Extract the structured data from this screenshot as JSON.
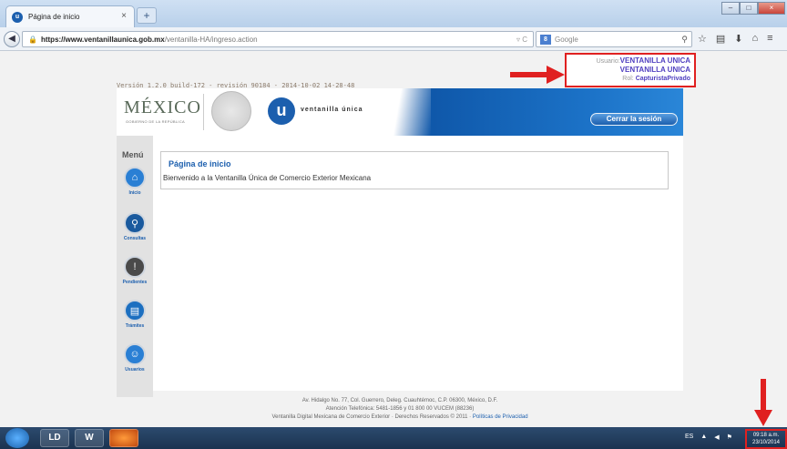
{
  "browser": {
    "tab_title": "Página de inicio",
    "tab_close": "×",
    "new_tab": "+",
    "url_host": "https://www.ventanillaunica.gob.mx",
    "url_path": "/ventanilla-HA/ingreso.action",
    "url_controls": "▿ C",
    "search_engine_letter": "8",
    "search_placeholder": "Google",
    "win_min": "–",
    "win_max": "□",
    "win_close": "×"
  },
  "page": {
    "version": "Versión 1.2.0 build-172 - revisión 90184 - 2014-10-02_14-28-48",
    "user_label": "Usuario:",
    "user_name_1": "VENTANILLA UNICA",
    "user_name_2": "VENTANILLA UNICA",
    "rol_label": "Rol:",
    "rol_value": "CapturistaPrivado",
    "mexico": "MÉXICO",
    "mexico_sub": "GOBIERNO DE LA REPÚBLICA",
    "vu_letter": "u",
    "vu_text": "ventanilla única",
    "logout": "Cerrar la sesión",
    "menu_title": "Menú",
    "menu": [
      {
        "label": "Inicio",
        "color": "#2a7fd4"
      },
      {
        "label": "Consultas",
        "color": "#1a5a9e"
      },
      {
        "label": "Pendientes",
        "color": "#4a4a4a"
      },
      {
        "label": "Trámites",
        "color": "#1c6fc0"
      },
      {
        "label": "Usuarios",
        "color": "#2a7fd4"
      }
    ],
    "panel_title": "Página de inicio",
    "panel_text": "Bienvenido a la Ventanilla Única de Comercio Exterior Mexicana",
    "footer_1": "Av. Hidalgo No. 77, Col. Guerrero, Deleg. Cuauhtémoc, C.P. 06300, México, D.F.",
    "footer_2": "Atención Telefónica: 5481-1856 y 01 800 00 VUCEM (88236)",
    "footer_3": "Ventanilla Digital Mexicana de Comercio Exterior · Derechos Reservados © 2011 ·",
    "footer_link": "Políticas de Privacidad"
  },
  "taskbar": {
    "apps": [
      "LD",
      "W"
    ],
    "lang": "ES",
    "time": "09:18 a.m.",
    "date": "23/10/2014"
  },
  "colors": {
    "accent": "#1c5fae",
    "highlight": "#e02020"
  }
}
